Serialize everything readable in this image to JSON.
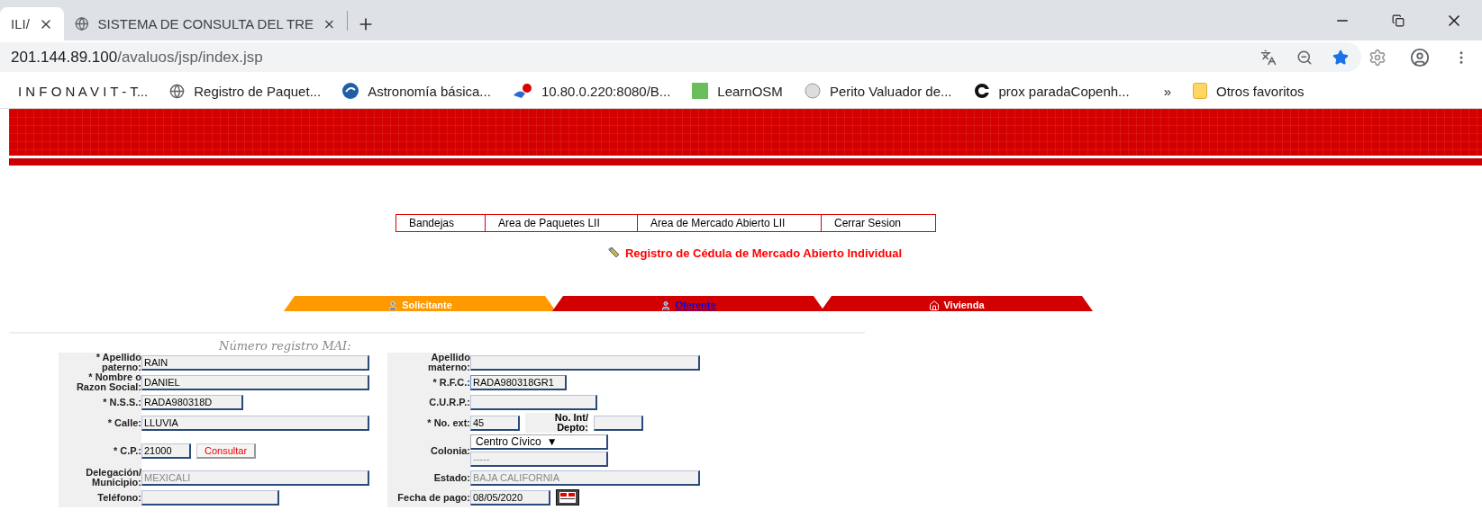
{
  "browser": {
    "tabs": [
      {
        "title": "ILI/",
        "selected": true
      },
      {
        "title": "SISTEMA DE CONSULTA DEL TRE",
        "selected": false
      }
    ],
    "url_host": "201.144.89.100",
    "url_path": "/avaluos/jsp/index.jsp",
    "bookmarks": [
      {
        "label": "I N F O N A V I T - T...",
        "kind": "none"
      },
      {
        "label": "Registro de Paquet...",
        "kind": "globe"
      },
      {
        "label": "Astronomía básica...",
        "kind": "swirl"
      },
      {
        "label": "10.80.0.220:8080/B...",
        "kind": "alert"
      },
      {
        "label": "LearnOSM",
        "kind": "square"
      },
      {
        "label": "Perito Valuador de...",
        "kind": "seal"
      },
      {
        "label": "prox paradaCopenh...",
        "kind": "ring"
      }
    ],
    "overflow": "»",
    "other_bookmarks": "Otros favoritos"
  },
  "nav_menu": [
    "Bandejas",
    "Area de Paquetes LII",
    "Area de Mercado Abierto LII",
    "Cerrar Sesion"
  ],
  "page_title": "Registro de Cédula de Mercado Abierto Individual",
  "section_tabs": [
    {
      "label": "Solicitante",
      "selected": true,
      "link": false,
      "kind": "person"
    },
    {
      "label": "Oferente",
      "selected": false,
      "link": true,
      "kind": "person"
    },
    {
      "label": "Vivienda",
      "selected": false,
      "link": false,
      "kind": "house"
    }
  ],
  "registro_label": "Número registro MAI:",
  "form_rows": [
    {
      "left": {
        "label": "* Apellido paterno:",
        "fields": [
          {
            "kind": "text",
            "value": "RAIN",
            "disabled": false,
            "focused": false
          }
        ]
      },
      "right": {
        "label": "Apellido materno:",
        "fields": [
          {
            "kind": "text",
            "focused": false
          }
        ]
      }
    },
    {
      "left": {
        "label": "* Nombre o Razon Social:",
        "fields": [
          {
            "kind": "text",
            "value": "DANIEL",
            "disabled": false,
            "focused": false
          }
        ]
      },
      "right": {
        "label": "* R.F.C.:",
        "fields": [
          {
            "kind": "text",
            "value": "RADA980318GR1",
            "disabled": false,
            "focused": true
          }
        ]
      }
    },
    {
      "left": {
        "label": "* N.S.S.:",
        "fields": [
          {
            "kind": "text",
            "value": "RADA980318D",
            "disabled": false,
            "focused": false
          }
        ]
      },
      "right": {
        "label": "C.U.R.P.:",
        "fields": [
          {
            "kind": "text",
            "focused": false
          }
        ]
      }
    },
    {
      "left": {
        "label": "* Calle:",
        "fields": [
          {
            "kind": "text",
            "value": "LLUVIA",
            "disabled": false,
            "focused": false
          }
        ]
      },
      "right": {
        "label": "* No. ext:",
        "fields": [
          {
            "kind": "text",
            "value": "45",
            "disabled": false,
            "focused": false
          },
          {
            "kind": "sublabel",
            "value": "No. Int/ Depto:"
          },
          {
            "kind": "text",
            "focused": false
          }
        ]
      }
    },
    {
      "left": {
        "label": "* C.P.:",
        "fields": [
          {
            "kind": "text",
            "value": "21000",
            "disabled": false,
            "focused": false
          },
          {
            "kind": "button",
            "value": "Consultar"
          }
        ]
      },
      "right": {
        "label": "Colonia:",
        "fields": [
          {
            "kind": "select",
            "value": "Centro Cívico",
            "caret": "▼"
          },
          {
            "kind": "text",
            "value": "-----",
            "disabled": true,
            "focused": false
          }
        ]
      }
    },
    {
      "left": {
        "label": "Delegación/ Municipio:",
        "fields": [
          {
            "kind": "text",
            "value": "MEXICALI",
            "disabled": true,
            "focused": false
          }
        ]
      },
      "right": {
        "label": "Estado:",
        "fields": [
          {
            "kind": "text",
            "value": "BAJA CALIFORNIA",
            "disabled": true,
            "focused": false
          }
        ]
      }
    },
    {
      "left": {
        "label": "Teléfono:",
        "fields": [
          {
            "kind": "text",
            "focused": false
          }
        ]
      },
      "right": {
        "label": "Fecha de pago:",
        "fields": [
          {
            "kind": "text",
            "value": "08/05/2020",
            "disabled": false,
            "focused": false
          },
          {
            "kind": "calendar"
          }
        ]
      }
    }
  ]
}
